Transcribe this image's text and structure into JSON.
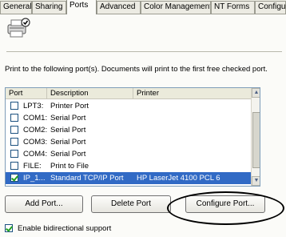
{
  "tabs": [
    {
      "label": "General",
      "active": false
    },
    {
      "label": "Sharing",
      "active": false
    },
    {
      "label": "Ports",
      "active": true
    },
    {
      "label": "Advanced",
      "active": false
    },
    {
      "label": "Color Management",
      "active": false
    },
    {
      "label": "NT Forms",
      "active": false
    },
    {
      "label": "Configu",
      "active": false
    }
  ],
  "printer_icon": "printer-icon",
  "description": "Print to the following port(s). Documents will print to the first free checked port.",
  "list": {
    "headers": {
      "port": "Port",
      "description": "Description",
      "printer": "Printer"
    },
    "rows": [
      {
        "port": "LPT3:",
        "description": "Printer Port",
        "printer": "",
        "checked": false,
        "selected": false
      },
      {
        "port": "COM1:",
        "description": "Serial Port",
        "printer": "",
        "checked": false,
        "selected": false
      },
      {
        "port": "COM2:",
        "description": "Serial Port",
        "printer": "",
        "checked": false,
        "selected": false
      },
      {
        "port": "COM3:",
        "description": "Serial Port",
        "printer": "",
        "checked": false,
        "selected": false
      },
      {
        "port": "COM4:",
        "description": "Serial Port",
        "printer": "",
        "checked": false,
        "selected": false
      },
      {
        "port": "FILE:",
        "description": "Print to File",
        "printer": "",
        "checked": false,
        "selected": false
      },
      {
        "port": "IP_1...",
        "description": "Standard TCP/IP Port",
        "printer": "HP LaserJet 4100 PCL 6",
        "checked": true,
        "selected": true
      }
    ]
  },
  "buttons": {
    "add_port": "Add Port...",
    "delete_port": "Delete Port",
    "configure_port": "Configure Port..."
  },
  "bidirectional": {
    "label": "Enable bidirectional support",
    "checked": true
  }
}
